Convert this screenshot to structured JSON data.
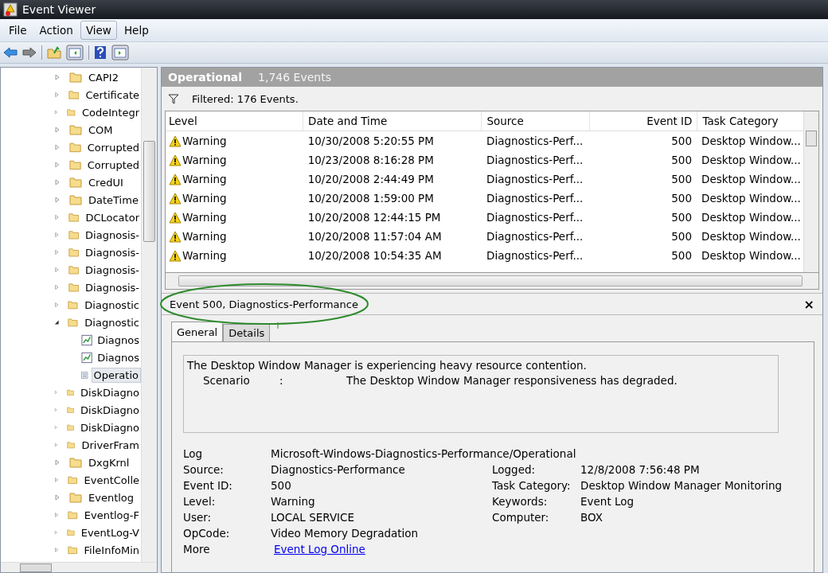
{
  "window": {
    "title": "Event Viewer"
  },
  "menu": [
    {
      "label": "File",
      "selected": false
    },
    {
      "label": "Action",
      "selected": false
    },
    {
      "label": "View",
      "selected": true
    },
    {
      "label": "Help",
      "selected": false
    }
  ],
  "tree": [
    {
      "label": "CAPI2",
      "expanded": false
    },
    {
      "label": "Certificate",
      "expanded": false
    },
    {
      "label": "CodeIntegr",
      "expanded": false
    },
    {
      "label": "COM",
      "expanded": false
    },
    {
      "label": "Corrupted",
      "expanded": false
    },
    {
      "label": "Corrupted",
      "expanded": false
    },
    {
      "label": "CredUI",
      "expanded": false
    },
    {
      "label": "DateTime",
      "expanded": false
    },
    {
      "label": "DCLocator",
      "expanded": false
    },
    {
      "label": "Diagnosis-",
      "expanded": false
    },
    {
      "label": "Diagnosis-",
      "expanded": false
    },
    {
      "label": "Diagnosis-",
      "expanded": false
    },
    {
      "label": "Diagnosis-",
      "expanded": false
    },
    {
      "label": "Diagnostic",
      "expanded": false
    },
    {
      "label": "Diagnostic",
      "expanded": true,
      "children": [
        {
          "label": "Diagnos",
          "kind": "chart",
          "selected": false
        },
        {
          "label": "Diagnos",
          "kind": "chart",
          "selected": false
        },
        {
          "label": "Operatio",
          "kind": "log",
          "selected": true
        }
      ]
    },
    {
      "label": "DiskDiagno",
      "expanded": false
    },
    {
      "label": "DiskDiagno",
      "expanded": false
    },
    {
      "label": "DiskDiagno",
      "expanded": false
    },
    {
      "label": "DriverFram",
      "expanded": false
    },
    {
      "label": "DxgKrnl",
      "expanded": false
    },
    {
      "label": "EventColle",
      "expanded": false
    },
    {
      "label": "Eventlog",
      "expanded": false
    },
    {
      "label": "Eventlog-F",
      "expanded": false
    },
    {
      "label": "EventLog-V",
      "expanded": false
    },
    {
      "label": "FileInfoMin",
      "expanded": false
    }
  ],
  "log_header": {
    "name": "Operational",
    "count": "1,746 Events"
  },
  "filter": "Filtered: 176 Events.",
  "table": {
    "columns": [
      "Level",
      "Date and Time",
      "Source",
      "Event ID",
      "Task Category"
    ],
    "rows": [
      [
        "Warning",
        "10/30/2008 5:20:55 PM",
        "Diagnostics-Perf...",
        "500",
        "Desktop Window..."
      ],
      [
        "Warning",
        "10/23/2008 8:16:28 PM",
        "Diagnostics-Perf...",
        "500",
        "Desktop Window..."
      ],
      [
        "Warning",
        "10/20/2008 2:44:49 PM",
        "Diagnostics-Perf...",
        "500",
        "Desktop Window..."
      ],
      [
        "Warning",
        "10/20/2008 1:59:00 PM",
        "Diagnostics-Perf...",
        "500",
        "Desktop Window..."
      ],
      [
        "Warning",
        "10/20/2008 12:44:15 PM",
        "Diagnostics-Perf...",
        "500",
        "Desktop Window..."
      ],
      [
        "Warning",
        "10/20/2008 11:57:04 AM",
        "Diagnostics-Perf...",
        "500",
        "Desktop Window..."
      ],
      [
        "Warning",
        "10/20/2008 10:54:35 AM",
        "Diagnostics-Perf...",
        "500",
        "Desktop Window..."
      ]
    ]
  },
  "detail": {
    "title": "Event 500, Diagnostics-Performance",
    "close": "×",
    "tabs": [
      {
        "label": "General",
        "selected": true
      },
      {
        "label": "Details",
        "selected": false
      }
    ],
    "description": "The Desktop Window Manager is experiencing heavy resource contention.",
    "scenario": {
      "label": "Scenario",
      "sep": ":",
      "value": "The Desktop Window Manager responsiveness has degraded."
    },
    "log": {
      "label": "Log",
      "value": "Microsoft-Windows-Diagnostics-Performance/Operational"
    },
    "fields": [
      {
        "label": "Source:",
        "value": "Diagnostics-Performance",
        "label2": "Logged:",
        "value2": "12/8/2008 7:56:48 PM"
      },
      {
        "label": "Event ID:",
        "value": "500",
        "label2": "Task Category:",
        "value2": "Desktop Window Manager Monitoring"
      },
      {
        "label": "Level:",
        "value": "Warning",
        "label2": "Keywords:",
        "value2": "Event Log"
      },
      {
        "label": "User:",
        "value": "LOCAL SERVICE",
        "label2": "Computer:",
        "value2": "BOX"
      },
      {
        "label": "OpCode:",
        "value": "Video Memory Degradation"
      }
    ],
    "more": {
      "label": "More",
      "link": "Event Log Online"
    }
  }
}
